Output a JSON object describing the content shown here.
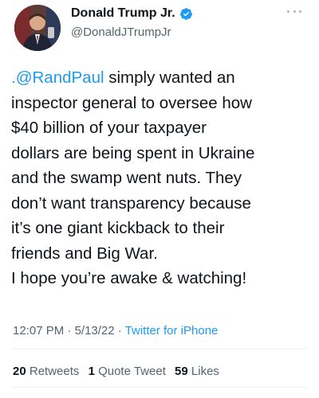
{
  "author": {
    "display_name": "Donald Trump Jr.",
    "handle": "@DonaldJTrumpJr",
    "verified_color": "#1d9bf0"
  },
  "tweet": {
    "mention": ".@RandPaul",
    "line1_rest": " simply wanted an",
    "lines": [
      "inspector general to oversee how",
      "$40 billion of your taxpayer",
      "dollars are being spent in Ukraine",
      "and the swamp went nuts. They",
      "don’t want transparency because",
      "it’s one giant kickback to their",
      "friends and Big War.",
      "I hope you’re awake & watching!"
    ]
  },
  "meta": {
    "time": "12:07 PM",
    "separator": " · ",
    "date": "5/13/22",
    "source": "Twitter for iPhone"
  },
  "stats": {
    "retweets_count": "20",
    "retweets_label": "Retweets",
    "quotes_count": "1",
    "quotes_label": "Quote Tweet",
    "likes_count": "59",
    "likes_label": "Likes"
  },
  "colors": {
    "link": "#1d9bf0",
    "text": "#0f1419",
    "secondary": "#536471"
  },
  "icons": {
    "verified": "verified-badge-icon",
    "more": "more-options-icon"
  }
}
